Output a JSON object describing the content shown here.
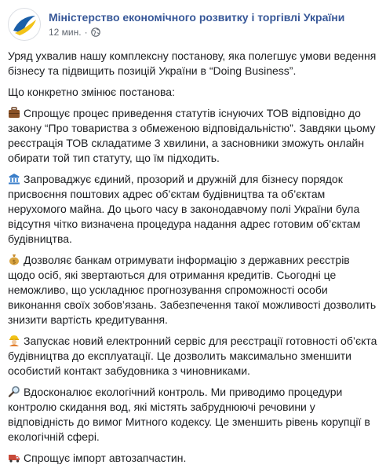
{
  "post": {
    "page_name": "Міністерство економічного розвитку і торгівлі України",
    "time": "12 мин.",
    "separator": "·",
    "intro": "Уряд ухвалив нашу комплексну постанову, яка полегшує умови ведення бізнесу та підвищить позицій України в “Doing Business”.",
    "subheading": "Що конкретно змінює постанова:",
    "points": [
      {
        "icon": "briefcase-icon",
        "text": "Спрощує процес приведення статутів існуючих ТОВ відповідно до закону “Про товариства з обмеженою відповідальністю”. Завдяки цьому реєстрація ТОВ складатиме 3 хвилини, а засновники зможуть онлайн обирати той тип статуту, що їм підходить."
      },
      {
        "icon": "bank-building-icon",
        "text": "Запроваджує єдиний, прозорий и дружній для бізнесу порядок присвоєння поштових адрес об’єктам будівництва та об’єктам нерухомого майна. До цього часу в законодавчому полі України була відсутня чітко визначена процедура надання адрес готовим об’єктам будівництва."
      },
      {
        "icon": "money-bag-icon",
        "text": "Дозволяє банкам отримувати інформацію з державних реєстрів щодо осіб, які звертаються для отримання кредитів. Сьогодні це неможливо, що ускладнює прогнозування спроможності особи виконання своїх зобов’язань. Забезпечення такої можливості дозволить знизити вартість кредитування."
      },
      {
        "icon": "construction-worker-icon",
        "text": "Запускає новий електронний сервіс для реєстрації готовності об’єкта будівництва до експлуатації. Це дозволить максимально зменшити особистий контакт забудовника з чиновниками."
      },
      {
        "icon": "magnifying-glass-icon",
        "text": "Вдосконалює екологічний контроль. Ми приводимо процедури контролю скидання вод, які містять забруднюючі речовини у відповідність до вимог Митного кодексу. Це зменшить рівень корупції в екологічній сфері."
      },
      {
        "icon": "truck-icon",
        "text": "Спрощує імпорт автозапчастин."
      }
    ]
  },
  "colors": {
    "link": "#385898",
    "text": "#1c1e21",
    "meta": "#606770"
  }
}
